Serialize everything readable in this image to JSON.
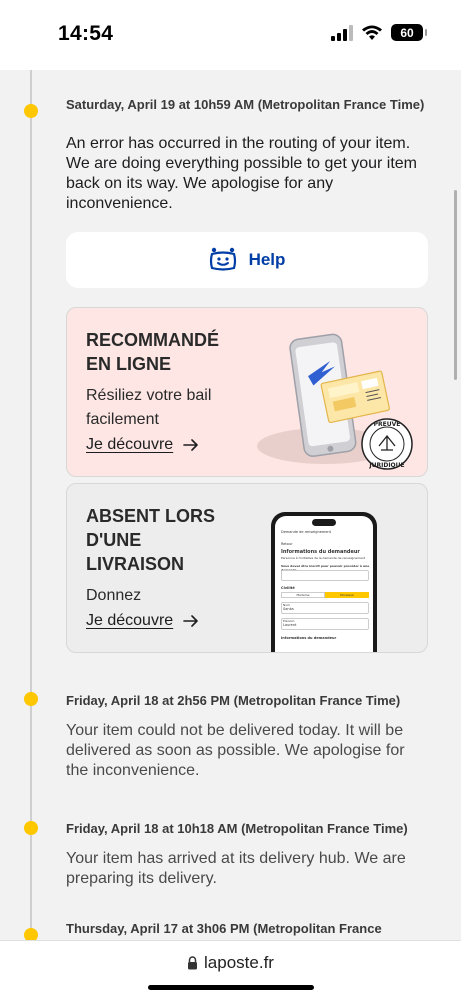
{
  "status_bar": {
    "time": "14:54",
    "battery": "60"
  },
  "events": [
    {
      "date": "Saturday, April 19 at 10h59 AM (Metropolitan France Time)",
      "text": "An error has occurred in the routing of your item. We are doing everything possible to get your item back on its way. We apologise for any inconvenience."
    },
    {
      "date": "Friday, April 18 at 2h56 PM (Metropolitan France Time)",
      "text": "Your item could not be delivered today. It will be delivered as soon as possible. We apologise for the inconvenience."
    },
    {
      "date": "Friday, April 18 at 10h18 AM (Metropolitan France Time)",
      "text": "Your item has arrived at its delivery hub. We are preparing its delivery."
    },
    {
      "date": "Thursday, April 17 at 3h06 PM (Metropolitan France"
    }
  ],
  "help": {
    "label": "Help"
  },
  "cards": [
    {
      "title_line1": "RECOMMANDÉ",
      "title_line2": "EN LIGNE",
      "desc_line1": "Résiliez votre bail",
      "desc_line2": "facilement",
      "link": "Je découvre",
      "stamp_top": "PREUVE",
      "stamp_bottom": "JURIDIQUE"
    },
    {
      "title_line1": "ABSENT LORS",
      "title_line2": "D'UNE",
      "title_line3": "LIVRAISON",
      "desc_line1": "Donnez",
      "link": "Je découvre",
      "phone": {
        "nav": "Demande de renseignement",
        "back": "Retour",
        "section": "Informations du demandeur",
        "sub": "Personne à l'initiative de la demande de renseignement",
        "question": "Vous devez être inscrit pour pouvoir procéder à une demande",
        "civility": "Civilité",
        "opt1": "Madame",
        "opt2": "Monsieur",
        "field1_label": "Nom",
        "field1": "Sanka",
        "field2_label": "Prénom",
        "field2": "Laurent",
        "section2": "Informations du demandeur"
      }
    }
  ],
  "browser": {
    "url": "laposte.fr"
  },
  "colors": {
    "timeline_dot": "#ffc700",
    "brand_blue": "#003da5",
    "card1_bg": "#fde6e4",
    "card2_bg": "#ededed"
  }
}
